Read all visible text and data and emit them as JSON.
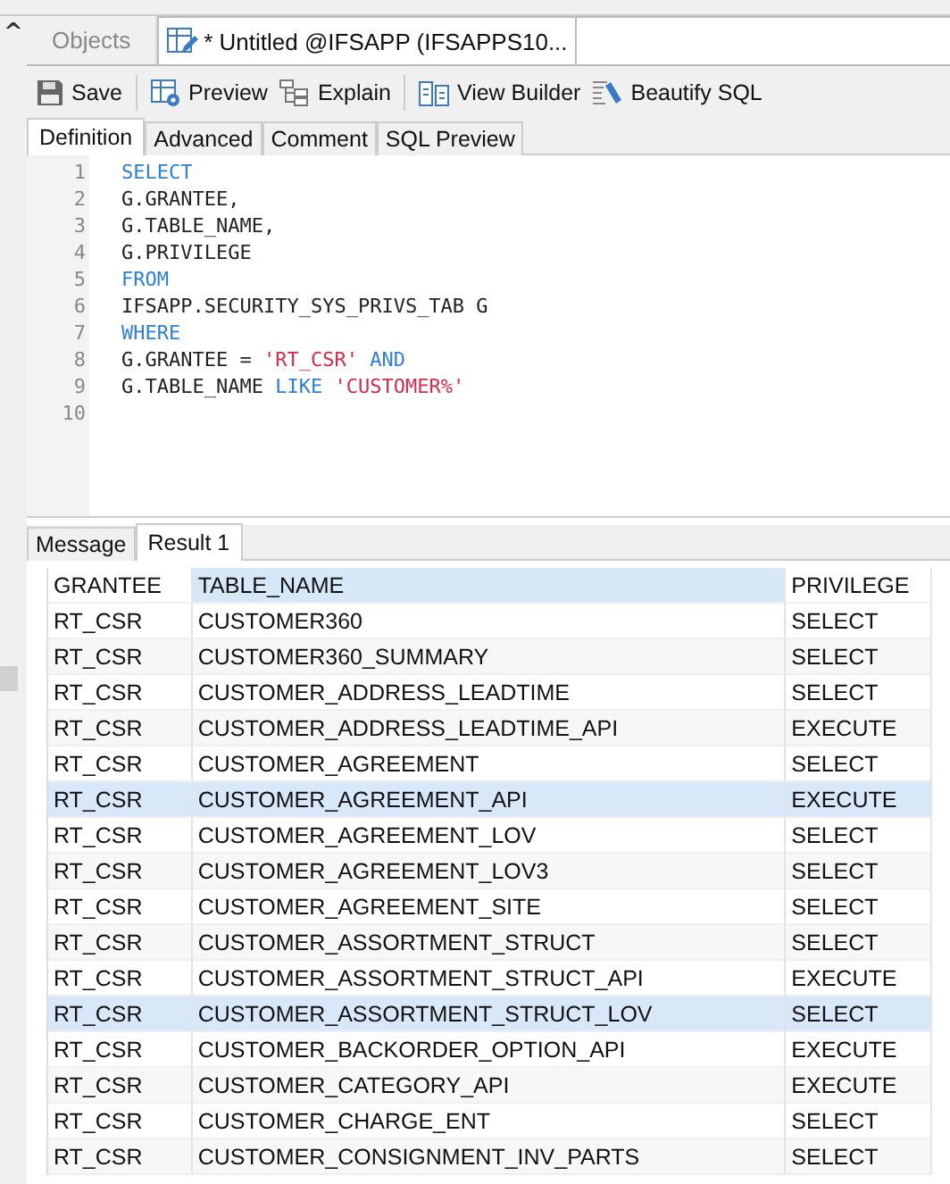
{
  "collapse_icon": "^",
  "doc_tabs": [
    {
      "label": "Objects",
      "selected": false,
      "kind": "plain"
    },
    {
      "label": "* Untitled @IFSAPP (IFSAPPS10...",
      "selected": true,
      "kind": "query"
    }
  ],
  "toolbar": [
    {
      "label": "Save",
      "kind": "save"
    },
    {
      "label": "Preview",
      "kind": "preview"
    },
    {
      "label": "Explain",
      "kind": "explain"
    },
    {
      "label": "View Builder",
      "kind": "builder"
    },
    {
      "label": "Beautify SQL",
      "kind": "beautify"
    }
  ],
  "editor_tabs": [
    {
      "label": "Definition",
      "selected": true
    },
    {
      "label": "Advanced",
      "selected": false
    },
    {
      "label": "Comment",
      "selected": false
    },
    {
      "label": "SQL Preview",
      "selected": false
    }
  ],
  "code_lines": [
    [
      {
        "kind": "keyword",
        "text": "SELECT"
      }
    ],
    [
      {
        "kind": "plain",
        "text": "G.GRANTEE,"
      }
    ],
    [
      {
        "kind": "plain",
        "text": "G.TABLE_NAME,"
      }
    ],
    [
      {
        "kind": "plain",
        "text": "G.PRIVILEGE"
      }
    ],
    [
      {
        "kind": "keyword",
        "text": "FROM"
      }
    ],
    [
      {
        "kind": "plain",
        "text": "IFSAPP.SECURITY_SYS_PRIVS_TAB G"
      }
    ],
    [
      {
        "kind": "keyword",
        "text": "WHERE"
      }
    ],
    [
      {
        "kind": "plain",
        "text": "G.GRANTEE = "
      },
      {
        "kind": "string",
        "text": "'RT_CSR'"
      },
      {
        "kind": "keyword",
        "text": " AND"
      }
    ],
    [
      {
        "kind": "plain",
        "text": "G.TABLE_NAME "
      },
      {
        "kind": "keyword",
        "text": "LIKE"
      },
      {
        "kind": "string",
        "text": " 'CUSTOMER%'"
      }
    ]
  ],
  "line_numbers": [
    "1",
    "2",
    "3",
    "4",
    "5",
    "6",
    "7",
    "8",
    "9",
    "10"
  ],
  "result_tabs": [
    {
      "label": "Message",
      "selected": false
    },
    {
      "label": "Result 1",
      "selected": true
    }
  ],
  "table": {
    "columns": [
      {
        "label": "GRANTEE",
        "selected": false
      },
      {
        "label": "TABLE_NAME",
        "selected": true
      },
      {
        "label": "PRIVILEGE",
        "selected": false
      }
    ],
    "rows": [
      {
        "cells": [
          "RT_CSR",
          "CUSTOMER360",
          "SELECT"
        ],
        "selected": false
      },
      {
        "cells": [
          "RT_CSR",
          "CUSTOMER360_SUMMARY",
          "SELECT"
        ],
        "selected": false
      },
      {
        "cells": [
          "RT_CSR",
          "CUSTOMER_ADDRESS_LEADTIME",
          "SELECT"
        ],
        "selected": false
      },
      {
        "cells": [
          "RT_CSR",
          "CUSTOMER_ADDRESS_LEADTIME_API",
          "EXECUTE"
        ],
        "selected": false
      },
      {
        "cells": [
          "RT_CSR",
          "CUSTOMER_AGREEMENT",
          "SELECT"
        ],
        "selected": false
      },
      {
        "cells": [
          "RT_CSR",
          "CUSTOMER_AGREEMENT_API",
          "EXECUTE"
        ],
        "selected": true
      },
      {
        "cells": [
          "RT_CSR",
          "CUSTOMER_AGREEMENT_LOV",
          "SELECT"
        ],
        "selected": false
      },
      {
        "cells": [
          "RT_CSR",
          "CUSTOMER_AGREEMENT_LOV3",
          "SELECT"
        ],
        "selected": false
      },
      {
        "cells": [
          "RT_CSR",
          "CUSTOMER_AGREEMENT_SITE",
          "SELECT"
        ],
        "selected": false
      },
      {
        "cells": [
          "RT_CSR",
          "CUSTOMER_ASSORTMENT_STRUCT",
          "SELECT"
        ],
        "selected": false
      },
      {
        "cells": [
          "RT_CSR",
          "CUSTOMER_ASSORTMENT_STRUCT_API",
          "EXECUTE"
        ],
        "selected": false
      },
      {
        "cells": [
          "RT_CSR",
          "CUSTOMER_ASSORTMENT_STRUCT_LOV",
          "SELECT"
        ],
        "selected": true
      },
      {
        "cells": [
          "RT_CSR",
          "CUSTOMER_BACKORDER_OPTION_API",
          "EXECUTE"
        ],
        "selected": false
      },
      {
        "cells": [
          "RT_CSR",
          "CUSTOMER_CATEGORY_API",
          "EXECUTE"
        ],
        "selected": false
      },
      {
        "cells": [
          "RT_CSR",
          "CUSTOMER_CHARGE_ENT",
          "SELECT"
        ],
        "selected": false
      },
      {
        "cells": [
          "RT_CSR",
          "CUSTOMER_CONSIGNMENT_INV_PARTS",
          "SELECT"
        ],
        "selected": false
      }
    ]
  }
}
